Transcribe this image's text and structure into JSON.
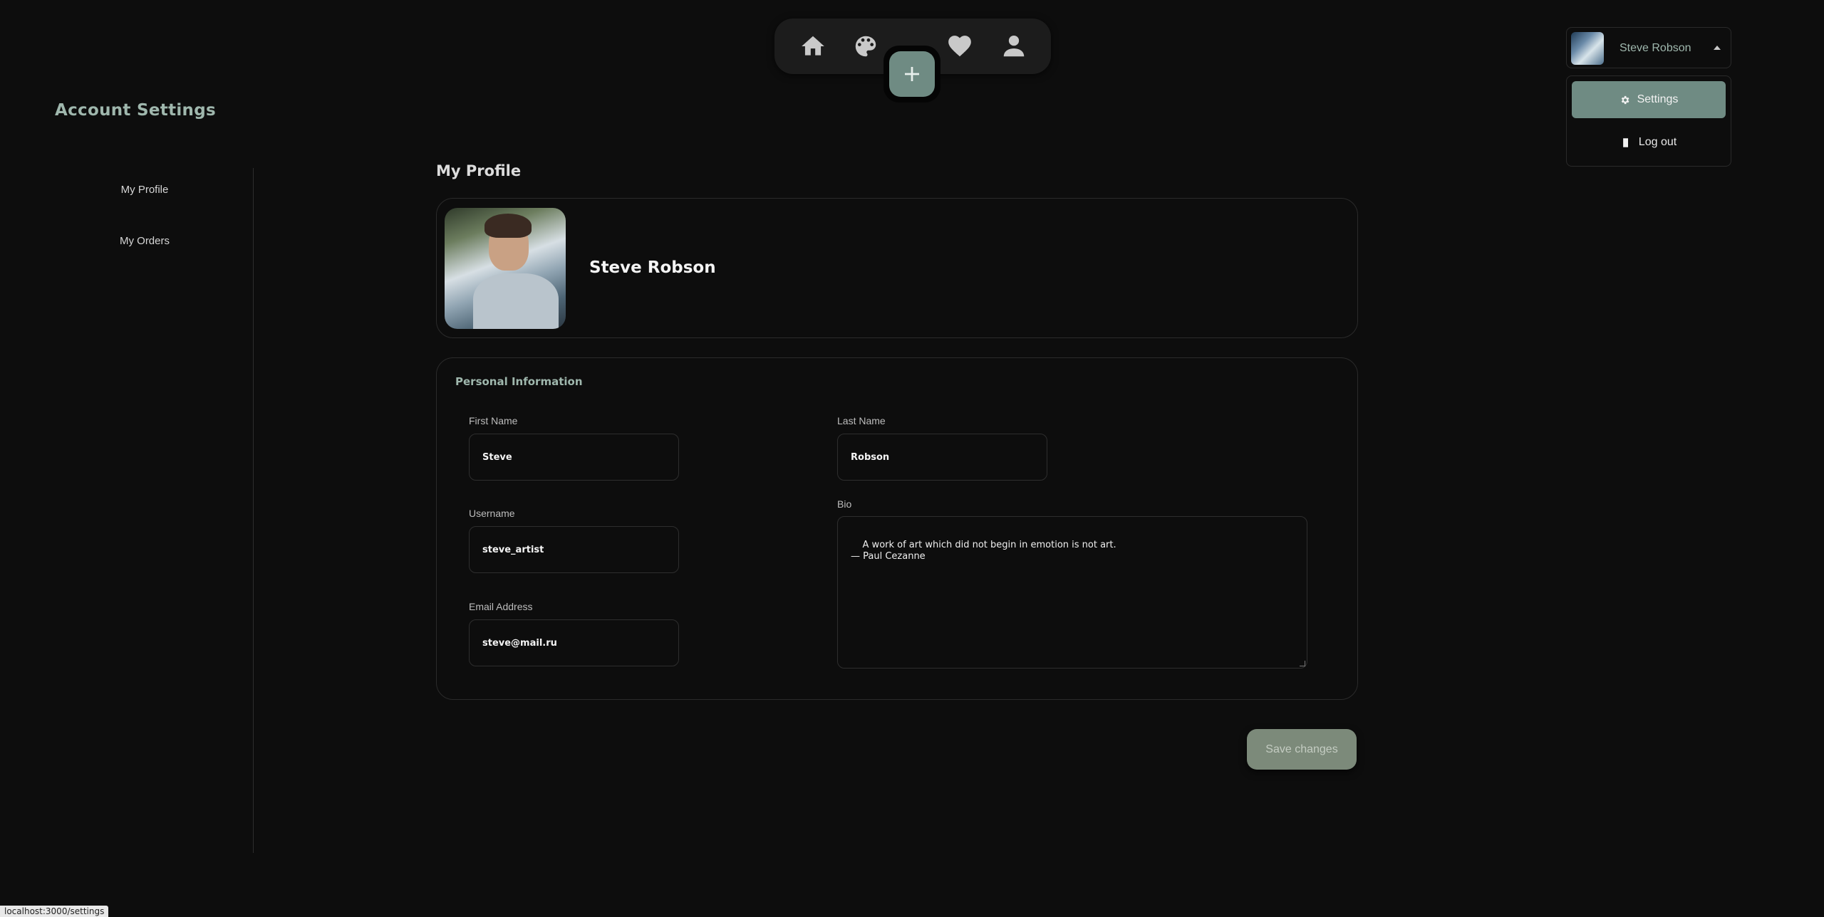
{
  "nav": {
    "items": [
      {
        "icon": "home-icon"
      },
      {
        "icon": "palette-icon"
      },
      {
        "icon": "heart-icon"
      },
      {
        "icon": "user-icon"
      }
    ],
    "add_icon": "plus-icon"
  },
  "user_menu": {
    "name": "Steve Robson",
    "items": [
      {
        "label": "Settings",
        "icon": "gear-icon"
      },
      {
        "label": "Log out",
        "icon": "logout-icon"
      }
    ]
  },
  "page": {
    "title": "Account Settings"
  },
  "sidebar": {
    "items": [
      {
        "label": "My Profile"
      },
      {
        "label": "My Orders"
      }
    ]
  },
  "profile": {
    "section_title": "My Profile",
    "full_name": "Steve Robson"
  },
  "personal_info": {
    "title": "Personal Information",
    "first_name": {
      "label": "First Name",
      "value": "Steve"
    },
    "last_name": {
      "label": "Last Name",
      "value": "Robson"
    },
    "username": {
      "label": "Username",
      "value": "steve_artist"
    },
    "email": {
      "label": "Email Address",
      "value": "steve@mail.ru"
    },
    "bio": {
      "label": "Bio",
      "value": "A work of art which did not begin in emotion is not art.\n— Paul Cezanne"
    }
  },
  "actions": {
    "save_label": "Save changes"
  },
  "status_bar": {
    "url": "localhost:3000/settings"
  },
  "colors": {
    "accent": "#6f8b83",
    "background": "#0d0d0d",
    "title_green": "#9fb7ad"
  }
}
